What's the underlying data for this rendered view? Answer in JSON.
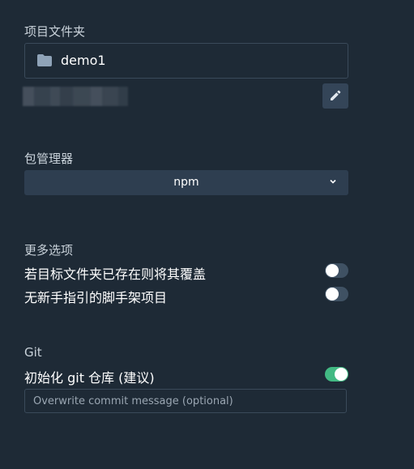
{
  "project_folder": {
    "label": "项目文件夹",
    "name": "demo1",
    "edit_icon": "pencil-icon",
    "folder_icon": "folder-icon"
  },
  "package_manager": {
    "label": "包管理器",
    "selected": "npm",
    "chevron_icon": "chevron-down-icon"
  },
  "more_options": {
    "label": "更多选项",
    "items": [
      {
        "label": "若目标文件夹已存在则将其覆盖",
        "enabled": false
      },
      {
        "label": "无新手指引的脚手架项目",
        "enabled": false
      }
    ]
  },
  "git": {
    "label": "Git",
    "init_label": "初始化 git 仓库 (建议)",
    "init_enabled": true,
    "commit_placeholder": "Overwrite commit message (optional)"
  },
  "colors": {
    "background": "#1e2a36",
    "accent_green": "#42b983",
    "select_bg": "#2e3e50"
  }
}
